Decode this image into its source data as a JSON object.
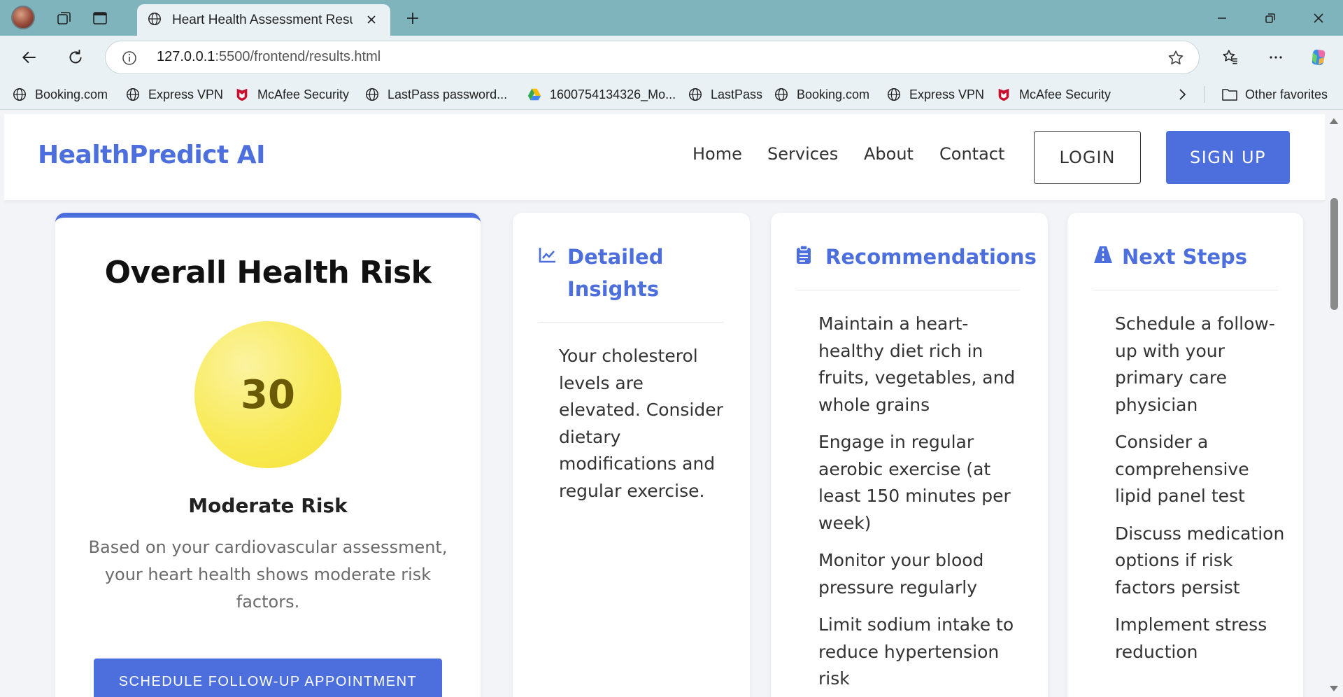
{
  "browser": {
    "tab": {
      "title": "Heart Health Assessment Results | ..."
    },
    "address": {
      "host": "127.0.0.1",
      "path": ":5500/frontend/results.html"
    },
    "favorites": [
      {
        "label": "Booking.com",
        "icon": "globe-icon"
      },
      {
        "label": "Express VPN",
        "icon": "globe-icon"
      },
      {
        "label": "McAfee Security",
        "icon": "mcafee-icon"
      },
      {
        "label": "LastPass password...",
        "icon": "globe-icon"
      },
      {
        "label": "1600754134326_Mo...",
        "icon": "google-drive-icon"
      },
      {
        "label": "LastPass",
        "icon": "globe-icon"
      },
      {
        "label": "Booking.com",
        "icon": "globe-icon"
      },
      {
        "label": "Express VPN",
        "icon": "globe-icon"
      },
      {
        "label": "McAfee Security",
        "icon": "mcafee-icon"
      }
    ],
    "other_favorites": "Other favorites"
  },
  "site": {
    "logo": "HealthPredict AI",
    "nav": [
      "Home",
      "Services",
      "About",
      "Contact"
    ],
    "login": "LOGIN",
    "signup": "SIGN UP",
    "accent_color": "#4d6fdd"
  },
  "risk": {
    "title": "Overall Health Risk",
    "score": "30",
    "level": "Moderate Risk",
    "description": "Based on your cardiovascular assessment, your heart health shows moderate risk factors.",
    "button": "SCHEDULE FOLLOW-UP APPOINTMENT",
    "circle_color": "#f8ea57"
  },
  "insights": {
    "title": "Detailed Insights",
    "icon": "chart-line-icon",
    "items": [
      "Your cholesterol levels are elevated. Consider dietary modifications and regular exercise."
    ]
  },
  "recommendations": {
    "title": "Recommendations",
    "icon": "clipboard-icon",
    "items": [
      "Maintain a heart-healthy diet rich in fruits, vegetables, and whole grains",
      "Engage in regular aerobic exercise (at least 150 minutes per week)",
      "Monitor your blood pressure regularly",
      "Limit sodium intake to reduce hypertension risk"
    ]
  },
  "next_steps": {
    "title": "Next Steps",
    "icon": "road-icon",
    "items": [
      "Schedule a follow-up with your primary care physician",
      "Consider a comprehensive lipid panel test",
      "Discuss medication options if risk factors persist",
      "Implement stress reduction"
    ]
  }
}
